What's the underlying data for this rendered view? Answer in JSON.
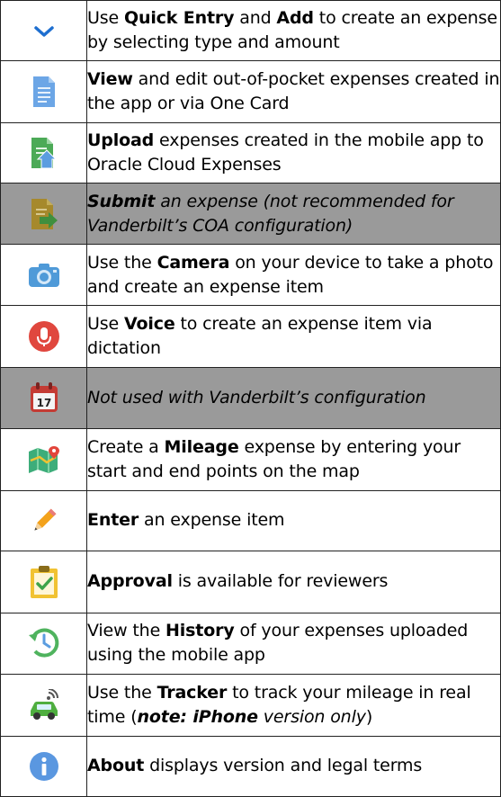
{
  "rows": [
    {
      "id": "quick-entry",
      "icon": "chevron-down-icon",
      "shaded": false,
      "segments": [
        {
          "t": "Use ",
          "b": false
        },
        {
          "t": "Quick Entry",
          "b": true
        },
        {
          "t": " and ",
          "b": false
        },
        {
          "t": "Add",
          "b": true
        },
        {
          "t": " to create an expense by selecting type and amount",
          "b": false
        }
      ]
    },
    {
      "id": "view",
      "icon": "document-icon",
      "shaded": false,
      "segments": [
        {
          "t": "View",
          "b": true
        },
        {
          "t": " and edit out-of-pocket expenses created in the app or via One Card",
          "b": false
        }
      ]
    },
    {
      "id": "upload",
      "icon": "upload-document-icon",
      "shaded": false,
      "segments": [
        {
          "t": "Upload",
          "b": true
        },
        {
          "t": " expenses created in the mobile app to Oracle Cloud Expenses",
          "b": false
        }
      ]
    },
    {
      "id": "submit",
      "icon": "submit-document-icon",
      "shaded": true,
      "segments": [
        {
          "t": "Submit",
          "b": true
        },
        {
          "t": " an expense (not recommended for Vanderbilt’s COA configuration)",
          "b": false
        }
      ]
    },
    {
      "id": "camera",
      "icon": "camera-icon",
      "shaded": false,
      "segments": [
        {
          "t": "Use the ",
          "b": false
        },
        {
          "t": "Camera",
          "b": true
        },
        {
          "t": " on your device to take a photo and create an expense item",
          "b": false
        }
      ]
    },
    {
      "id": "voice",
      "icon": "microphone-icon",
      "shaded": false,
      "segments": [
        {
          "t": "Use ",
          "b": false
        },
        {
          "t": "Voice",
          "b": true
        },
        {
          "t": " to create an expense item via dictation",
          "b": false
        }
      ]
    },
    {
      "id": "calendar",
      "icon": "calendar-icon",
      "shaded": true,
      "calendar_day": "17",
      "segments": [
        {
          "t": "Not used with Vanderbilt’s configuration",
          "b": false
        }
      ]
    },
    {
      "id": "mileage",
      "icon": "map-icon",
      "shaded": false,
      "segments": [
        {
          "t": "Create a ",
          "b": false
        },
        {
          "t": "Mileage",
          "b": true
        },
        {
          "t": " expense by entering your start and end points on the map",
          "b": false
        }
      ]
    },
    {
      "id": "enter",
      "icon": "pencil-icon",
      "shaded": false,
      "segments": [
        {
          "t": "Enter",
          "b": true
        },
        {
          "t": " an expense item",
          "b": false
        }
      ]
    },
    {
      "id": "approval",
      "icon": "clipboard-check-icon",
      "shaded": false,
      "segments": [
        {
          "t": "Approval",
          "b": true
        },
        {
          "t": " is available for reviewers",
          "b": false
        }
      ]
    },
    {
      "id": "history",
      "icon": "history-icon",
      "shaded": false,
      "segments": [
        {
          "t": "View the ",
          "b": false
        },
        {
          "t": "History",
          "b": true
        },
        {
          "t": " of your expenses uploaded using the mobile app",
          "b": false
        }
      ]
    },
    {
      "id": "tracker",
      "icon": "car-tracker-icon",
      "shaded": false,
      "segments": [
        {
          "t": "Use the ",
          "b": false
        },
        {
          "t": "Tracker",
          "b": true
        },
        {
          "t": " to track your mileage in real time (",
          "b": false
        },
        {
          "t": "note: iPhone",
          "b": true,
          "i": true
        },
        {
          "t": " version only",
          "b": false,
          "i": true
        },
        {
          "t": ")",
          "b": false
        }
      ]
    },
    {
      "id": "about",
      "icon": "info-icon",
      "shaded": false,
      "segments": [
        {
          "t": "About",
          "b": true
        },
        {
          "t": " displays version and legal terms",
          "b": false
        }
      ]
    }
  ],
  "colors": {
    "shaded_row": "#9a9a9a",
    "chevron": "#1e6fd0",
    "document": "#6ca6e6",
    "upload_green": "#4caa57",
    "camera": "#4f9ad8",
    "mic_red": "#e0473e",
    "calendar_red": "#c43b34",
    "pencil": "#f3a21c",
    "history_green": "#4fb35e",
    "car_green": "#4fae3f",
    "info_blue": "#5a97e0"
  }
}
